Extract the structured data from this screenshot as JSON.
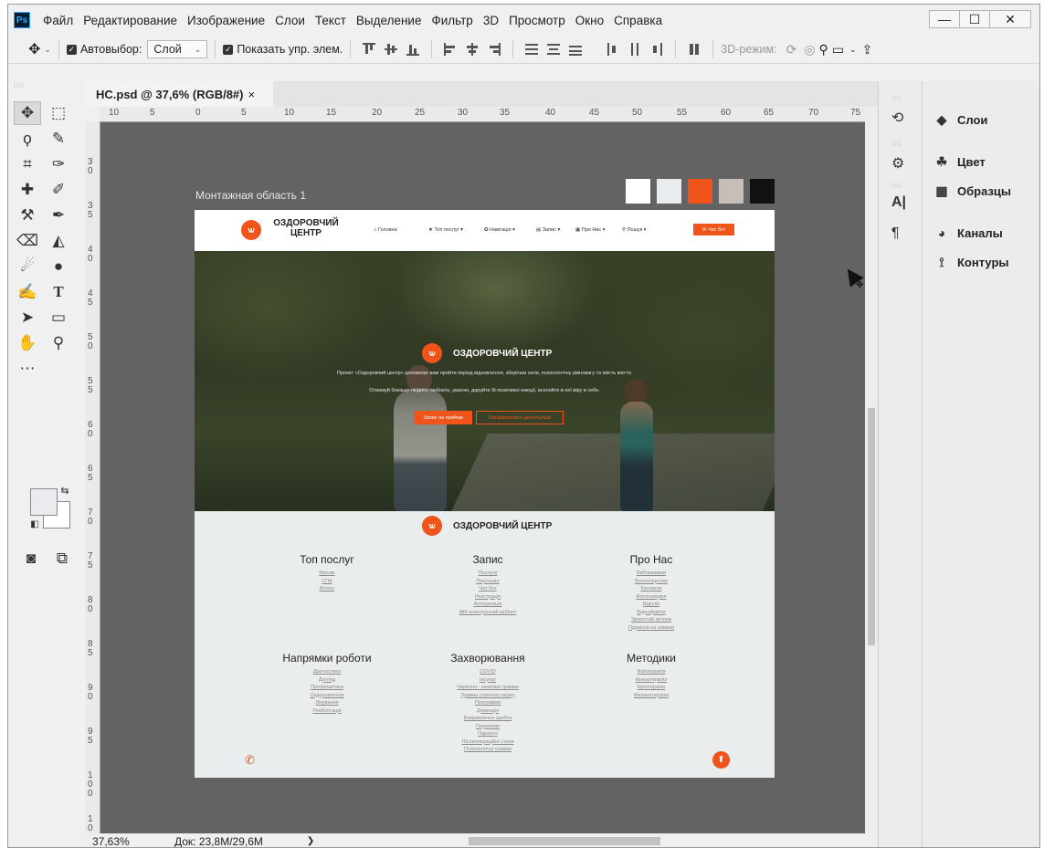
{
  "app": {
    "logo": "Ps",
    "menu": [
      "Файл",
      "Редактирование",
      "Изображение",
      "Слои",
      "Текст",
      "Выделение",
      "Фильтр",
      "3D",
      "Просмотр",
      "Окно",
      "Справка"
    ],
    "window_controls": {
      "minimize": "—",
      "maximize": "☐",
      "close": "✕"
    }
  },
  "options": {
    "autoselect_label": "Автовыбор:",
    "autoselect_value": "Слой",
    "show_controls_label": "Показать упр. элем.",
    "mode_3d_label": "3D-режим:"
  },
  "document": {
    "tab_title": "HC.psd @ 37,6% (RGB/8#)",
    "tab_close": "×",
    "ruler_top": [
      "10",
      "5",
      "0",
      "5",
      "10",
      "15",
      "20",
      "25",
      "30",
      "35",
      "40",
      "45",
      "50",
      "55",
      "60",
      "65",
      "70",
      "75"
    ],
    "ruler_left": [
      "3",
      "0",
      "3",
      "5",
      "4",
      "0",
      "4",
      "5",
      "5",
      "0",
      "5",
      "5",
      "6",
      "0",
      "6",
      "5",
      "7",
      "0",
      "7",
      "5",
      "8",
      "0",
      "8",
      "5",
      "9",
      "0",
      "9",
      "5",
      "100",
      "10"
    ],
    "zoom": "37,63%",
    "doc_info": "Док: 23,8M/29,6M",
    "status_arrow": "❯"
  },
  "artboard": {
    "label": "Монтажная область 1",
    "swatches": [
      "#ffffff",
      "#e8ecee",
      "#f1541b",
      "#c8beb9",
      "#111111"
    ]
  },
  "site": {
    "logo_line1": "ОЗДОРОВЧИЙ",
    "logo_line2": "ЦЕНТР",
    "nav": [
      "Головна",
      "Топ послуг ▾",
      "Навігація ▾",
      "Запис ▾",
      "Про Нас ▾",
      "Пошук ▾"
    ],
    "chat_button": "Чат бот",
    "hero_title": "ОЗДОРОВЧИЙ ЦЕНТР",
    "hero_line1": "Проект «Оздоровчий центр» допоможе вам пройти період відновлення, зберігши сили, психологічну рівновагу та якість життя.",
    "hero_line2": "Отримуй близьку людину любов'ю, увагою, даруйте їй позитивні емоції, вселяйте в неї віру в себе.",
    "btn_primary": "Запис на прийом",
    "btn_secondary": "Ознайомитися детальніше",
    "footer_title": "ОЗДОРОВЧИЙ ЦЕНТР",
    "columns": [
      {
        "title": "Топ послуг",
        "links": [
          "Масаж",
          "СПА",
          "Фітнес"
        ]
      },
      {
        "title": "Запис",
        "links": [
          "Послуги",
          "Персонал",
          "Чат бот",
          "Реєстрація",
          "Авторизація",
          "Мій електронний кабінет"
        ]
      },
      {
        "title": "Про Нас",
        "links": [
          "Вибомнимки",
          "Волонтерство",
          "Контакти",
          "Фотогалерея",
          "Відгуки",
          "Відеофайли",
          "Зворотній зв'язок",
          "Підписка на новини"
        ]
      },
      {
        "title": "Напрямки роботи",
        "links": [
          "Діагностика",
          "Догляд",
          "Профілактика",
          "Оздоровлення",
          "Лікування",
          "Реабілітація"
        ]
      },
      {
        "title": "Захворювання",
        "links": [
          "COVID",
          "Інсульт",
          "Черепно - мозкова травма",
          "Травма спинного мозку",
          "Протравми",
          "Деменція",
          "Викривлення хребта",
          "Переломи",
          "Паралічі",
          "Післяопераційні стани",
          "Психологічні травми"
        ]
      },
      {
        "title": "Методики",
        "links": [
          "Фізіотерапія",
          "Кінезотерапія",
          "Ерготерапія",
          "Механотерапія"
        ]
      }
    ]
  },
  "panels": {
    "layers": "Слои",
    "color": "Цвет",
    "swatches": "Образцы",
    "channels": "Каналы",
    "paths": "Контуры"
  }
}
